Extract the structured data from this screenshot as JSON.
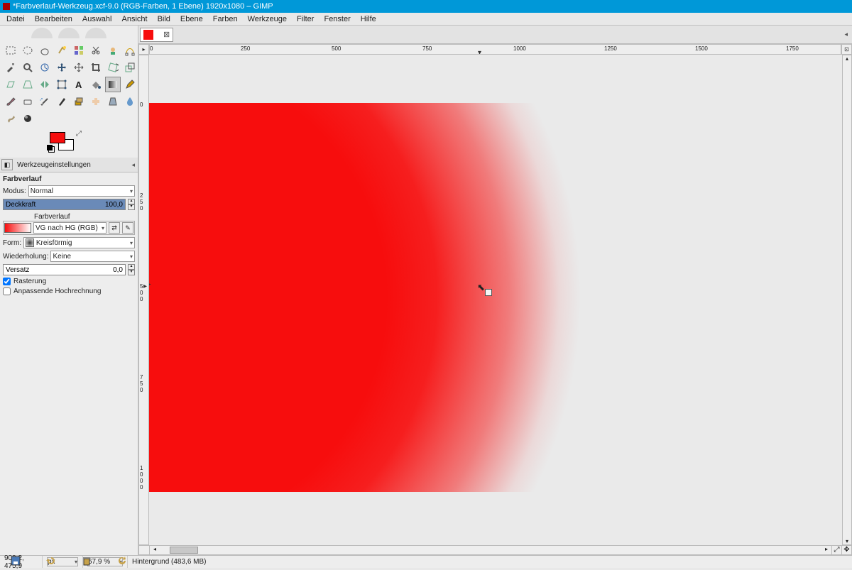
{
  "title": "*Farbverlauf-Werkzeug.xcf-9.0 (RGB-Farben, 1 Ebene) 1920x1080 – GIMP",
  "menu": [
    "Datei",
    "Bearbeiten",
    "Auswahl",
    "Ansicht",
    "Bild",
    "Ebene",
    "Farben",
    "Werkzeuge",
    "Filter",
    "Fenster",
    "Hilfe"
  ],
  "colors": {
    "fg": "#f70d0d",
    "bg": "#ffffff"
  },
  "tool_options_tab": "Werkzeugeinstellungen",
  "options": {
    "title": "Farbverlauf",
    "mode_label": "Modus:",
    "mode_value": "Normal",
    "opacity_label": "Deckkraft",
    "opacity_value": "100,0",
    "gradient_label": "Farbverlauf",
    "gradient_name": "VG nach HG (RGB)",
    "shape_label": "Form:",
    "shape_value": "Kreisförmig",
    "repeat_label": "Wiederholung:",
    "repeat_value": "Keine",
    "offset_label": "Versatz",
    "offset_value": "0,0",
    "dithering": "Rasterung",
    "supersample": "Anpassende Hochrechnung"
  },
  "ruler_h": {
    "0": "0",
    "250": "250",
    "500": "500",
    "750": "750",
    "1000": "1000",
    "1250": "1250",
    "1500": "1500",
    "1750": "1750"
  },
  "ruler_v": {
    "0": "0",
    "250": "2\n5\n0",
    "500": "5\n0\n0",
    "750": "7\n5\n0",
    "1000": "1\n0\n0\n0"
  },
  "status": {
    "pos": "909,2, 475,9",
    "unit": "px",
    "zoom": "67,9 %",
    "layer": "Hintergrund (483,6 MB)"
  }
}
